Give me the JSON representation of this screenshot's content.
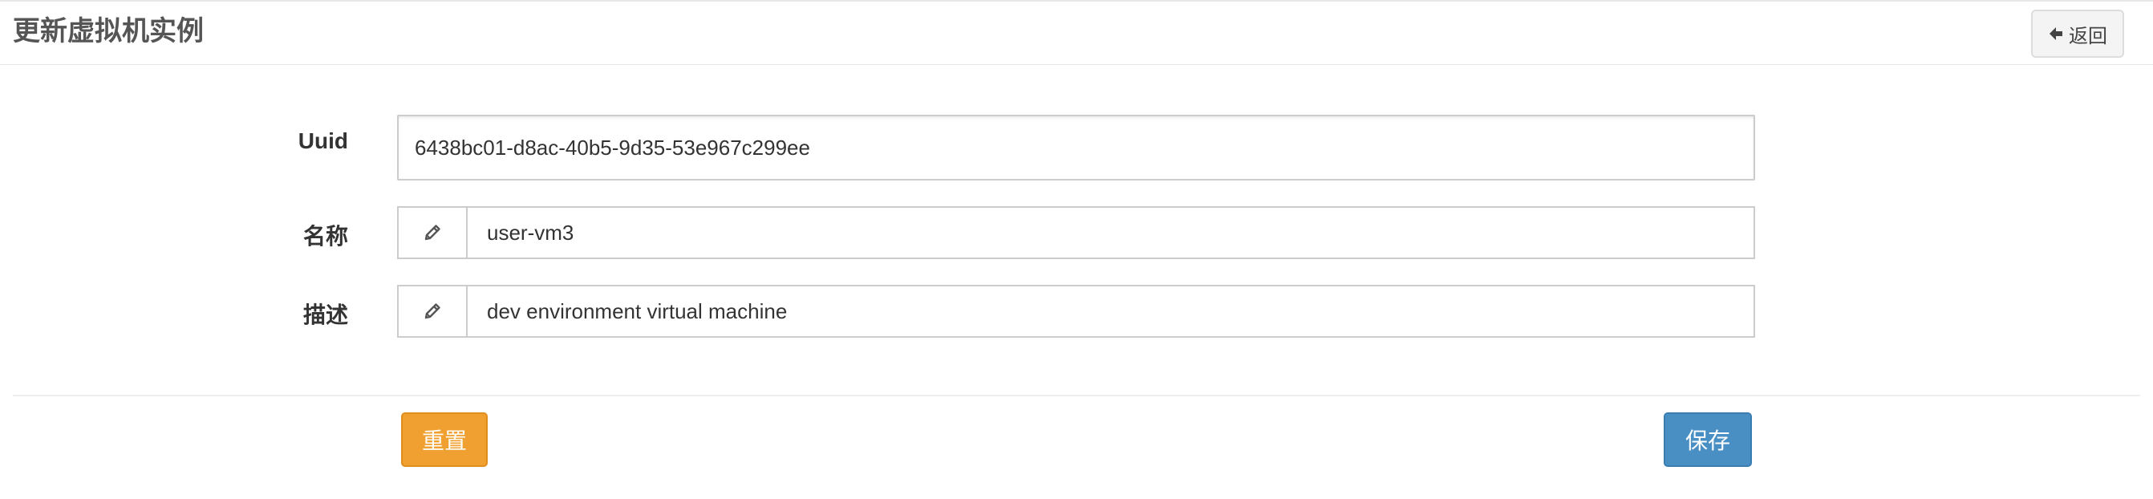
{
  "header": {
    "title": "更新虚拟机实例",
    "back_label": "返回"
  },
  "form": {
    "uuid": {
      "label": "Uuid",
      "value": "6438bc01-d8ac-40b5-9d35-53e967c299ee"
    },
    "name": {
      "label": "名称",
      "value": "user-vm3"
    },
    "description": {
      "label": "描述",
      "value": "dev environment virtual machine"
    }
  },
  "actions": {
    "reset_label": "重置",
    "save_label": "保存"
  },
  "icons": {
    "back": "arrow-left-icon",
    "edit": "pencil-icon"
  },
  "colors": {
    "reset": "#f0a030",
    "save": "#4a8fc4"
  }
}
